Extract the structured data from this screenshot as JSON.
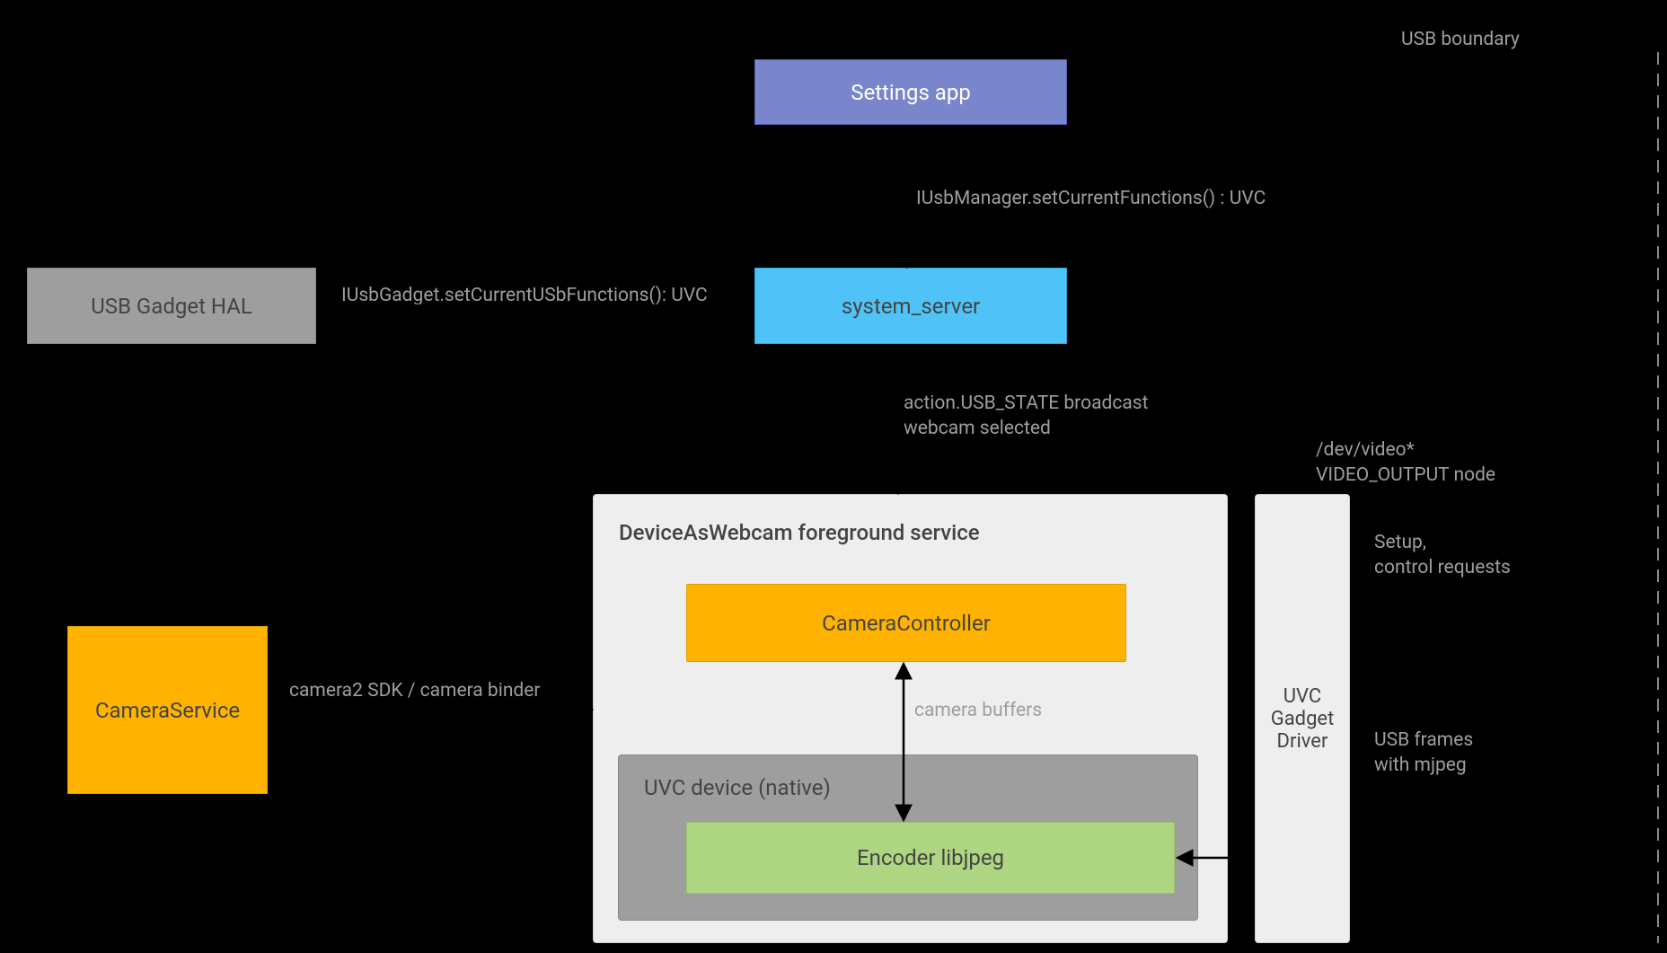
{
  "boxes": {
    "settings_app": "Settings app",
    "usb_gadget_hal": "USB Gadget HAL",
    "system_server": "system_server",
    "camera_service": "CameraService",
    "daw_title": "DeviceAsWebcam foreground service",
    "camera_controller": "CameraController",
    "uvc_native_title": "UVC device (native)",
    "encoder": "Encoder libjpeg",
    "uvc_driver": "UVC\nGadget\nDriver"
  },
  "labels": {
    "usb_boundary": "USB boundary",
    "iusbmanager": "IUsbManager.setCurrentFunctions() : UVC",
    "iusbgadget": "IUsbGadget.setCurrentUSbFunctions(): UVC",
    "usb_state": "action.USB_STATE broadcast\nwebcam selected",
    "dev_video": "/dev/video*\nVIDEO_OUTPUT node",
    "setup": "Setup,\ncontrol requests",
    "camera2": "camera2 SDK / camera binder",
    "camera_buffers": "camera buffers",
    "usb_frames": "USB frames\nwith mjpeg"
  },
  "chart_data": {
    "type": "diagram",
    "title": "Android DeviceAsWebcam / UVC gadget architecture",
    "nodes": [
      {
        "id": "settings_app",
        "label": "Settings app"
      },
      {
        "id": "system_server",
        "label": "system_server"
      },
      {
        "id": "usb_gadget_hal",
        "label": "USB Gadget HAL"
      },
      {
        "id": "camera_service",
        "label": "CameraService"
      },
      {
        "id": "daw_service",
        "label": "DeviceAsWebcam foreground service",
        "children": [
          {
            "id": "camera_controller",
            "label": "CameraController"
          },
          {
            "id": "uvc_device_native",
            "label": "UVC device (native)",
            "children": [
              {
                "id": "encoder_libjpeg",
                "label": "Encoder libjpeg"
              }
            ]
          }
        ]
      },
      {
        "id": "uvc_gadget_driver",
        "label": "UVC Gadget Driver"
      }
    ],
    "edges": [
      {
        "from": "settings_app",
        "to": "system_server",
        "label": "IUsbManager.setCurrentFunctions() : UVC",
        "dir": "one"
      },
      {
        "from": "system_server",
        "to": "usb_gadget_hal",
        "label": "IUsbGadget.setCurrentUSbFunctions(): UVC",
        "dir": "one"
      },
      {
        "from": "system_server",
        "to": "daw_service",
        "label": "action.USB_STATE broadcast\nwebcam selected",
        "dir": "one"
      },
      {
        "from": "camera_controller",
        "to": "encoder_libjpeg",
        "label": "camera buffers",
        "dir": "both"
      },
      {
        "from": "camera_service",
        "to": "daw_service",
        "label": "camera2 SDK / camera binder",
        "dir": "one"
      },
      {
        "from": "uvc_gadget_driver",
        "to": "encoder_libjpeg",
        "label": "",
        "dir": "one"
      },
      {
        "from": "uvc_gadget_driver",
        "to": "usb_boundary",
        "label": "/dev/video* VIDEO_OUTPUT node / Setup, control requests / USB frames with mjpeg",
        "dir": "both",
        "note": "USB boundary"
      }
    ]
  }
}
